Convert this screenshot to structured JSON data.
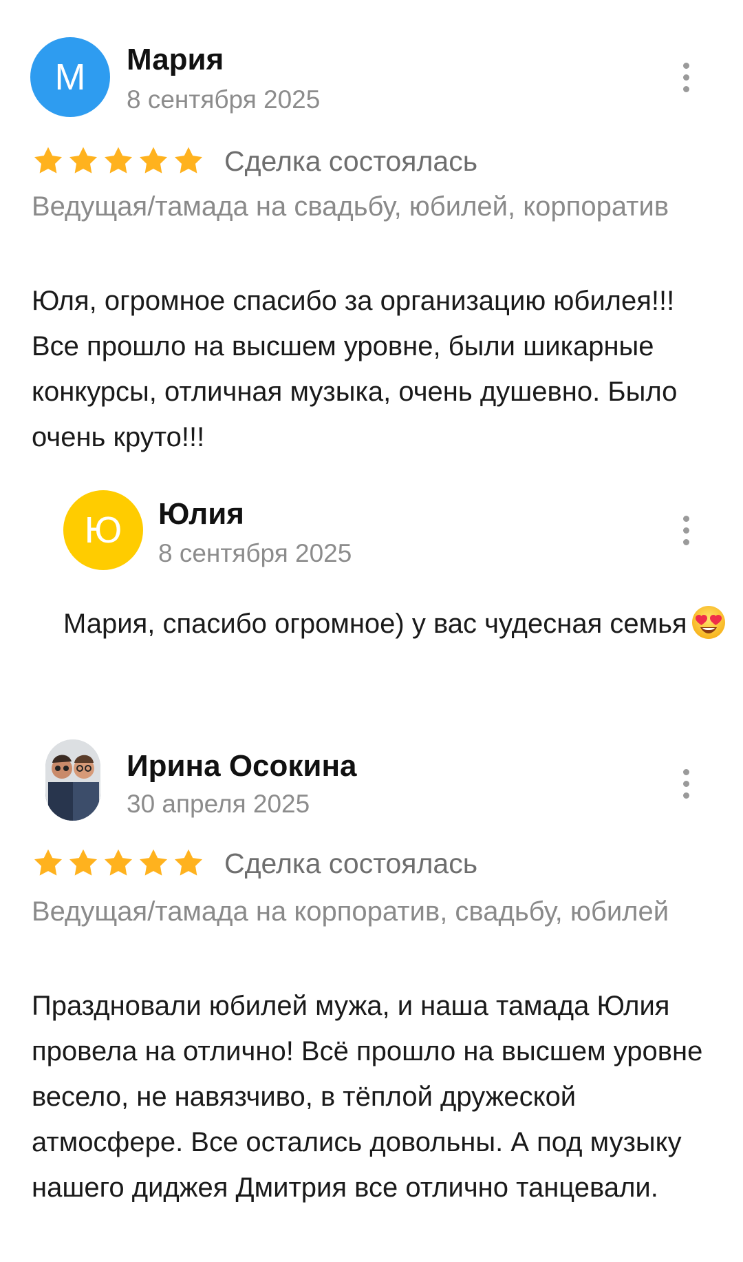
{
  "reviews": [
    {
      "author": "Мария",
      "avatar_letter": "М",
      "avatar_color": "#2e9cf0",
      "date": "8 сентября 2025",
      "rating": 5,
      "deal_status": "Сделка состоялась",
      "service": "Ведущая/тамада на свадьбу, юбилей, корпоратив",
      "text": "Юля, огромное спасибо  за организацию юбилея!!! Все прошло на высшем уровне, были шикарные конкурсы, отличная музыка, очень душевно. Было очень круто!!!",
      "reply": {
        "author": "Юлия",
        "avatar_letter": "Ю",
        "avatar_color": "#ffcc00",
        "date": "8 сентября 2025",
        "text": "Мария, спасибо огромное) у вас чудесная семья",
        "emoji": "heart-eyes-emoji"
      }
    },
    {
      "author": "Ирина Осокина",
      "avatar_type": "photo",
      "date": "30 апреля 2025",
      "rating": 5,
      "deal_status": "Сделка состоялась",
      "service": "Ведущая/тамада на корпоратив, свадьбу, юбилей",
      "text": "Праздновали юбилей мужа, и наша тамада Юлия провела на отлично! Всё прошло на высшем уровне весело, не навязчиво, в тёплой дружеской атмосфере. Все остались довольны. А под музыку нашего диджея Дмитрия все отлично танцевали."
    }
  ],
  "colors": {
    "star": "#ffb21e",
    "muted_text": "#8a8a8a",
    "main_text": "#1a1a1a"
  },
  "icons": {
    "menu": "more-vertical-icon",
    "star": "star-icon"
  }
}
